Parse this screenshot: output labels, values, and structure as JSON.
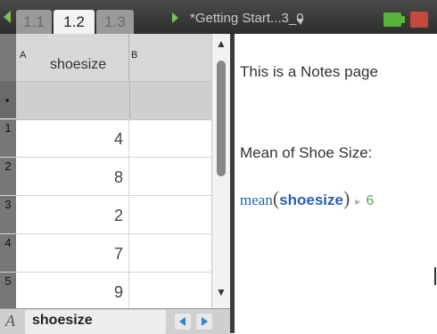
{
  "tabs": [
    {
      "label": "1.1",
      "active": false
    },
    {
      "label": "1.2",
      "active": true
    },
    {
      "label": "1.3",
      "active": false
    }
  ],
  "document_title": "*Getting Start...3_0",
  "icons": {
    "nav_left": "arrow-left-icon",
    "nav_right": "arrow-right-icon",
    "dropdown": "chevron-down-icon",
    "battery": "battery-icon",
    "close": "close-icon"
  },
  "colors": {
    "accent_green": "#7ec25a",
    "battery_green": "#59b23a",
    "close_red": "#c24a3e",
    "math_blue": "#2a5fb0",
    "result_green": "#59a35a"
  },
  "spreadsheet": {
    "columns": [
      {
        "letter": "A",
        "name": "shoesize"
      },
      {
        "letter": "B",
        "name": ""
      }
    ],
    "formula_row_marker": "•",
    "rows": [
      {
        "num": "1",
        "a": "4"
      },
      {
        "num": "2",
        "a": "8"
      },
      {
        "num": "3",
        "a": "2"
      },
      {
        "num": "4",
        "a": "7"
      },
      {
        "num": "5",
        "a": "9"
      }
    ]
  },
  "bottom_bar": {
    "cell_ref_icon": "A",
    "label": "shoesize"
  },
  "notes": {
    "heading": "This is a Notes page",
    "mean_label": "Mean of Shoe Size:",
    "mean_function": "mean",
    "mean_argument": "shoesize",
    "mean_arrow": "▸",
    "mean_result": "6"
  }
}
